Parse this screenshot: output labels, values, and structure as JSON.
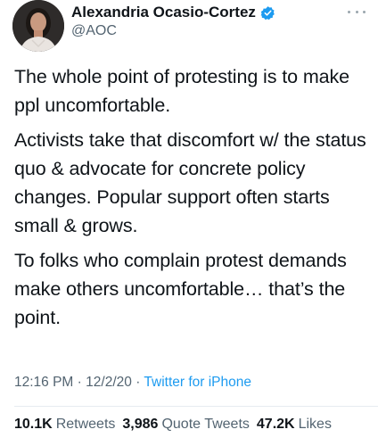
{
  "author": {
    "display_name": "Alexandria Ocasio-Cortez",
    "handle": "@AOC",
    "verified": true
  },
  "tweet": {
    "paragraphs": [
      "The whole point of protesting is to make ppl uncomfortable.",
      "Activists take that discomfort w/ the status quo & advocate for concrete policy changes. Popular support often starts small & grows.",
      "To folks who complain protest demands make others uncomfortable… that’s the point."
    ],
    "time": "12:16 PM",
    "date": "12/2/20",
    "separator": "·",
    "source": "Twitter for iPhone"
  },
  "stats": {
    "retweets": {
      "count": "10.1K",
      "label": "Retweets"
    },
    "quote_tweets": {
      "count": "3,986",
      "label": "Quote Tweets"
    },
    "likes": {
      "count": "47.2K",
      "label": "Likes"
    }
  },
  "icons": {
    "verified": "verified-badge-icon",
    "more": "more-options-icon"
  },
  "colors": {
    "accent": "#1d9bf0",
    "text": "#0f1419",
    "secondary": "#536471"
  }
}
